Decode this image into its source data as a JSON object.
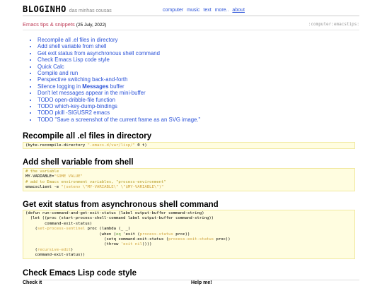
{
  "header": {
    "brand": "BLOGINHO",
    "tagline": "das minhas cousas",
    "nav": [
      "computer",
      "music",
      "text",
      "more..",
      "about"
    ]
  },
  "post": {
    "title": "Emacs tips & snippets",
    "date": "(25 July, 2022)",
    "tags": ":computer:emacstips:"
  },
  "toc": {
    "items": [
      "Recompile all .el files in directory",
      "Add shell variable from shell",
      "Get exit status from asynchronous shell command",
      "Check Emacs Lisp code style",
      "Quick Calc",
      "Compile and run",
      "Perspective switching back-and-forth",
      "Silence logging in",
      "Messages",
      "buffer",
      "Don't let messages appear in the mini-buffer",
      "TODO open-dribble-file function",
      "TODO which-key-dump-bindings",
      "TODO pkill -SIGUSR2 emacs",
      "TODO \"Save a screenshot of the current frame as an SVG image.\""
    ]
  },
  "sections": {
    "s1": {
      "title": "Recompile all .el files in directory",
      "code": [
        "(byte-recompile-directory ",
        "\".emacs.d/var/lisp/\"",
        " 0 t)"
      ]
    },
    "s2": {
      "title": "Add shell variable from shell",
      "code": [
        "# the variable",
        "MY-VARIABLE=",
        "\"SOME VALUE\"",
        "# add to Emacs environment variables, \"process-environment\"",
        "emacsclient -e ",
        "\"(setenv \\\"MY-VARIABLE\\\" \\\"$MY-VARIABLE\\\")\""
      ]
    },
    "s3": {
      "title": "Get exit status from asynchronous shell command",
      "code": [
        "(defun run-command-and-get-exit-status (label output-buffer command-string)",
        "  (let ((proc (start-process-shell-command label output-buffer command-string))",
        "        command-exit-status)",
        "    (",
        "set-process-sentinel",
        " proc (lambda (_ _)",
        "                               (when (",
        "eq",
        " 'exit (",
        "process-status",
        " proc))",
        "                                 (setq command-exit-status (",
        "process-exit-status",
        " proc))",
        "                                 (throw ",
        "'exit nil",
        "))))",
        "    (",
        "recursive-edit",
        ")",
        "    command-exit-status))"
      ]
    },
    "s4": {
      "title": "Check Emacs Lisp code style",
      "col1": "Check it",
      "col2": "Help me!"
    }
  }
}
